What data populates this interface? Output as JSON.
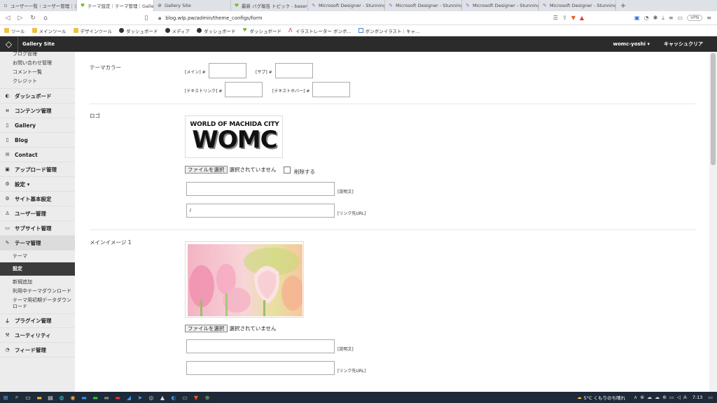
{
  "browser": {
    "tabs": [
      {
        "label": "ユーザー一覧｜ユーザー管理｜シス",
        "active": false
      },
      {
        "label": "テーマ設定｜テーマ管理｜Galle",
        "active": true
      },
      {
        "label": "Gallery Site",
        "active": false
      },
      {
        "label": "最新 バグ報告 トピック - baserCM",
        "active": false
      },
      {
        "label": "Microsoft Designer - Stunning",
        "active": false
      },
      {
        "label": "Microsoft Designer - Stunning",
        "active": false
      },
      {
        "label": "Microsoft Designer - Stunning",
        "active": false
      },
      {
        "label": "Microsoft Designer - Stunning",
        "active": false
      }
    ],
    "url": "blog.wlp.pw/admin/theme_configs/form",
    "vpn": "VPN",
    "bookmarks": [
      "ツール",
      "メインツール",
      "デザインツール",
      "ダッシュボード",
      "メディア",
      "ダッシュボード",
      "ダッシュボード",
      "イラストレーター ボンボ...",
      "ボンボンイラスト｜キャ..."
    ]
  },
  "header": {
    "site_name": "Gallery Site",
    "user": "womc-yoshi ▾",
    "clear_cache": "キャッシュクリア"
  },
  "sidebar": {
    "top_subitems": [
      "ブログ管理",
      "お問い合わせ管理",
      "コメント一覧",
      "クレジット"
    ],
    "menu": [
      {
        "label": "ダッシュボード",
        "icon": "dashboard-icon"
      },
      {
        "label": "コンテンツ管理",
        "icon": "sitemap-icon"
      },
      {
        "label": "Gallery",
        "icon": "file-icon"
      },
      {
        "label": "Blog",
        "icon": "file-icon"
      },
      {
        "label": "Contact",
        "icon": "mail-icon"
      },
      {
        "label": "アップロード管理",
        "icon": "image-icon"
      },
      {
        "label": "設定 ▾",
        "icon": "gear-icon"
      },
      {
        "label": "サイト基本設定",
        "icon": "gear-icon"
      },
      {
        "label": "ユーザー管理",
        "icon": "user-icon"
      },
      {
        "label": "サブサイト管理",
        "icon": "window-icon"
      },
      {
        "label": "テーマ管理",
        "icon": "brush-icon"
      }
    ],
    "theme_subitems": [
      "テーマ",
      "設定",
      "新規追加",
      "利用中テーマダウンロード",
      "テーマ用初期データダウンロード"
    ],
    "bottom_menu": [
      {
        "label": "プラグイン管理",
        "icon": "plug-icon"
      },
      {
        "label": "ユーティリティ",
        "icon": "wrench-icon"
      },
      {
        "label": "フィード管理",
        "icon": "rss-icon"
      }
    ]
  },
  "form": {
    "theme_color": {
      "label": "テーマカラー",
      "main": "[メイン] #",
      "sub": "[サブ] #",
      "text_link": "[テキストリンク] #",
      "text_hover": "[テキストホバー] #",
      "main_value": "",
      "sub_value": "",
      "link_value": "",
      "hover_value": ""
    },
    "logo": {
      "label": "ロゴ",
      "logo_line1": "WORLD OF MACHIDA CITY",
      "logo_line2": "WOMC",
      "file_button": "ファイルを選択",
      "file_status": "選択されていません",
      "delete_label": "削除する",
      "alt_value": "",
      "alt_label": "[説明文]",
      "link_value": "/",
      "link_label": "[リンク先URL]"
    },
    "main_image_1": {
      "label": "メインイメージ 1",
      "file_button": "ファイルを選択",
      "file_status": "選択されていません",
      "alt_value": "",
      "alt_label": "[説明文]",
      "link_value": "",
      "link_label": "[リンク先URL]"
    }
  },
  "taskbar": {
    "weather": "5°C くもりのち晴れ",
    "time": "7:13"
  }
}
